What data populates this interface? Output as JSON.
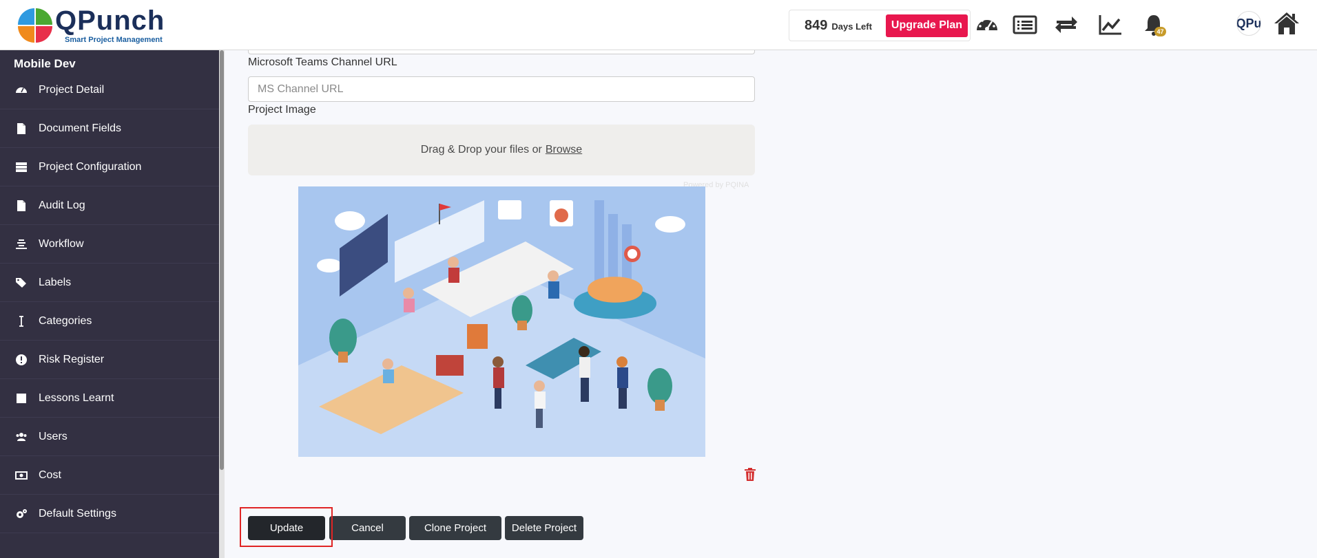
{
  "header": {
    "logo_name": "QPunch",
    "logo_tagline": "Smart Project Management",
    "days_number": "849",
    "days_label": "Days Left",
    "upgrade_label": "Upgrade Plan",
    "notification_count": "47",
    "avatar_text": "QPu",
    "icons": [
      "dashboard-icon",
      "list-icon",
      "sync-icon",
      "chart-line-icon",
      "bell-icon",
      "avatar",
      "home-icon"
    ]
  },
  "sidebar": {
    "project_name": "Mobile Dev",
    "items": [
      {
        "label": "Project Detail",
        "icon": "tachometer-icon"
      },
      {
        "label": "Document Fields",
        "icon": "file-icon"
      },
      {
        "label": "Project Configuration",
        "icon": "server-icon"
      },
      {
        "label": "Audit Log",
        "icon": "file-icon"
      },
      {
        "label": "Workflow",
        "icon": "workflow-icon"
      },
      {
        "label": "Labels",
        "icon": "tags-icon"
      },
      {
        "label": "Categories",
        "icon": "i-cursor-icon"
      },
      {
        "label": "Risk Register",
        "icon": "exclamation-circle-icon"
      },
      {
        "label": "Lessons Learnt",
        "icon": "square-icon"
      },
      {
        "label": "Users",
        "icon": "users-icon"
      },
      {
        "label": "Cost",
        "icon": "money-icon"
      },
      {
        "label": "Default Settings",
        "icon": "cogs-icon"
      }
    ]
  },
  "form": {
    "teams_label": "Microsoft Teams Channel URL",
    "teams_placeholder": "MS Channel URL",
    "image_label": "Project Image",
    "dropzone_text": "Drag & Drop your files or",
    "dropzone_browse": "Browse",
    "powered_by": "Powered by PQINA"
  },
  "actions": {
    "update": "Update",
    "cancel": "Cancel",
    "clone": "Clone Project",
    "delete": "Delete Project"
  },
  "colors": {
    "sidebar_bg": "#333042",
    "upgrade_bg": "#e8174e",
    "button_bg": "#343a40",
    "highlight": "#e02424"
  }
}
